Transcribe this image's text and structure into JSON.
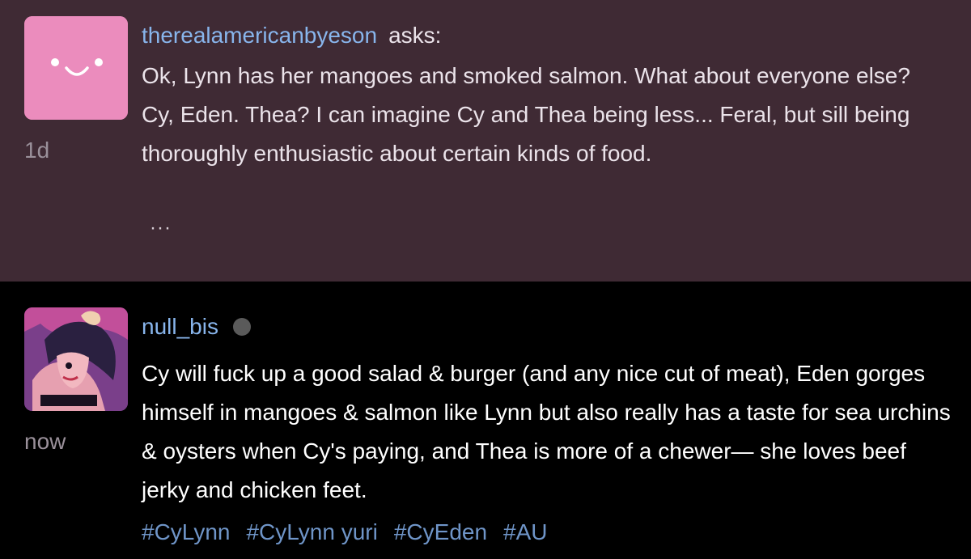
{
  "ask": {
    "username": "therealamericanbyeson",
    "verb": "asks:",
    "time": "1d",
    "text": "Ok, Lynn has her mangoes and smoked salmon. What about everyone else? Cy, Eden. Thea? I can imagine Cy and Thea being less... Feral, but sill being thoroughly enthusiastic about certain kinds of food.",
    "more": "···",
    "avatar_color": "#eb8cbd"
  },
  "reply": {
    "username": "null_bis",
    "time": "now",
    "text": "Cy will fuck up a good salad & burger (and any nice cut of meat), Eden gorges himself in mangoes & salmon like Lynn but also really has a taste for sea urchins & oysters when Cy's paying, and Thea is more of a chewer— she loves beef jerky and chicken feet.",
    "tags": [
      "#CyLynn",
      "#CyLynn yuri",
      "#CyEden",
      "#AU"
    ]
  },
  "colors": {
    "ask_background": "#3f2a34",
    "reply_background": "#000000",
    "username": "#88b5ec",
    "tag": "#6f95c8",
    "status_dot": "#5a5a5a"
  }
}
